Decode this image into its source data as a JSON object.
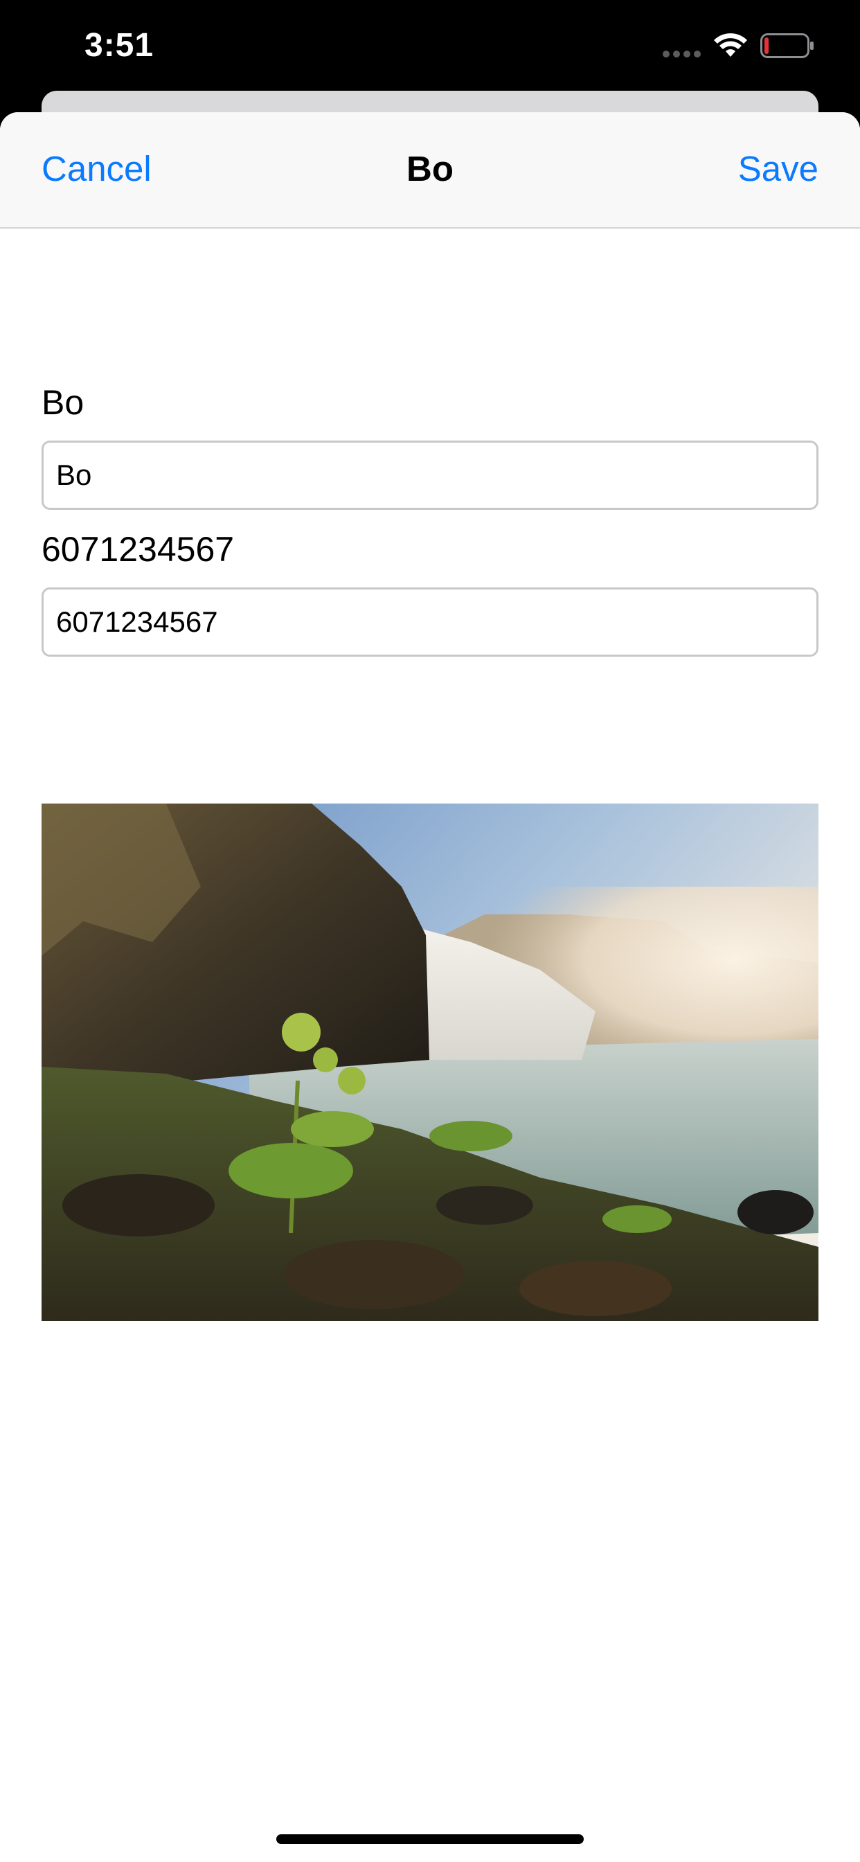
{
  "status_bar": {
    "time": "3:51",
    "signal_icon": "cellular-signal-icon",
    "wifi_icon": "wifi-icon",
    "battery_icon": "battery-low-icon",
    "battery_level": 0.1
  },
  "nav": {
    "cancel_label": "Cancel",
    "title": "Bo",
    "save_label": "Save"
  },
  "form": {
    "name_label": "Bo",
    "name_value": "Bo",
    "phone_label": "6071234567",
    "phone_value": "6071234567"
  },
  "photo": {
    "subject": "waterfall landscape photo"
  },
  "colors": {
    "accent": "#0a7afe",
    "battery_low": "#e5333a",
    "field_border": "#c8c8cc"
  }
}
